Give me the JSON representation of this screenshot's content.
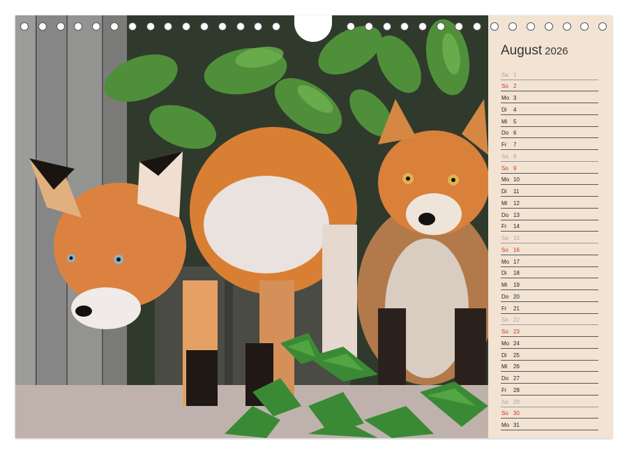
{
  "calendar": {
    "month": "August",
    "year": "2026",
    "days": [
      {
        "dn": "Sa",
        "d": "1",
        "type": "sat"
      },
      {
        "dn": "So",
        "d": "2",
        "type": "sun"
      },
      {
        "dn": "Mo",
        "d": "3",
        "type": "wd"
      },
      {
        "dn": "Di",
        "d": "4",
        "type": "wd"
      },
      {
        "dn": "Mi",
        "d": "5",
        "type": "wd"
      },
      {
        "dn": "Do",
        "d": "6",
        "type": "wd"
      },
      {
        "dn": "Fr",
        "d": "7",
        "type": "wd"
      },
      {
        "dn": "Sa",
        "d": "8",
        "type": "sat"
      },
      {
        "dn": "So",
        "d": "9",
        "type": "sun"
      },
      {
        "dn": "Mo",
        "d": "10",
        "type": "wd"
      },
      {
        "dn": "Di",
        "d": "11",
        "type": "wd"
      },
      {
        "dn": "Mi",
        "d": "12",
        "type": "wd"
      },
      {
        "dn": "Do",
        "d": "13",
        "type": "wd"
      },
      {
        "dn": "Fr",
        "d": "14",
        "type": "wd"
      },
      {
        "dn": "Sa",
        "d": "15",
        "type": "sat"
      },
      {
        "dn": "So",
        "d": "16",
        "type": "sun"
      },
      {
        "dn": "Mo",
        "d": "17",
        "type": "wd"
      },
      {
        "dn": "Di",
        "d": "18",
        "type": "wd"
      },
      {
        "dn": "Mi",
        "d": "19",
        "type": "wd"
      },
      {
        "dn": "Do",
        "d": "20",
        "type": "wd"
      },
      {
        "dn": "Fr",
        "d": "21",
        "type": "wd"
      },
      {
        "dn": "Sa",
        "d": "22",
        "type": "sat"
      },
      {
        "dn": "So",
        "d": "23",
        "type": "sun"
      },
      {
        "dn": "Mo",
        "d": "24",
        "type": "wd"
      },
      {
        "dn": "Di",
        "d": "25",
        "type": "wd"
      },
      {
        "dn": "Mi",
        "d": "26",
        "type": "wd"
      },
      {
        "dn": "Do",
        "d": "27",
        "type": "wd"
      },
      {
        "dn": "Fr",
        "d": "28",
        "type": "wd"
      },
      {
        "dn": "Sa",
        "d": "29",
        "type": "sat"
      },
      {
        "dn": "So",
        "d": "30",
        "type": "sun"
      },
      {
        "dn": "Mo",
        "d": "31",
        "type": "wd"
      }
    ]
  },
  "colors": {
    "sidebar_bg": "#f2e3d3",
    "sunday": "#c0392b",
    "saturday": "#a8a8a8",
    "fox_orange": "#d9803a"
  }
}
